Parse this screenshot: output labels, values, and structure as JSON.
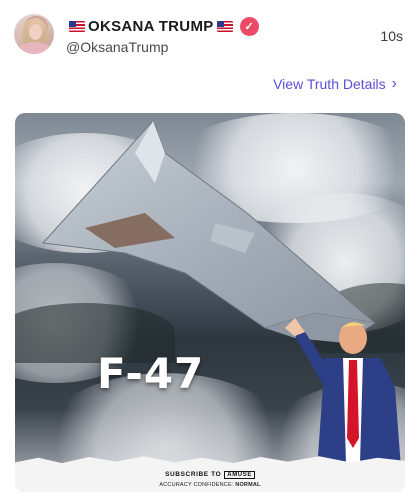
{
  "post": {
    "display_name": "OKSANA TRUMP",
    "handle": "@OksanaTrump",
    "timestamp": "10s",
    "details_link": "View Truth Details",
    "media": {
      "overlay_text": "F-47",
      "subscribe_text": "SUBSCRIBE TO",
      "subscribe_brand": "AMUSE",
      "confidence_label": "ACCURACY CONFIDENCE:",
      "confidence_value": "NORMAL"
    }
  },
  "icons": {
    "flag_left": "us-flag-icon",
    "flag_right": "us-flag-icon",
    "verified": "verified-badge-icon",
    "chevron": "chevron-right-icon"
  },
  "colors": {
    "verified_badge": "#ec4b68",
    "link": "#5b4fd6"
  }
}
